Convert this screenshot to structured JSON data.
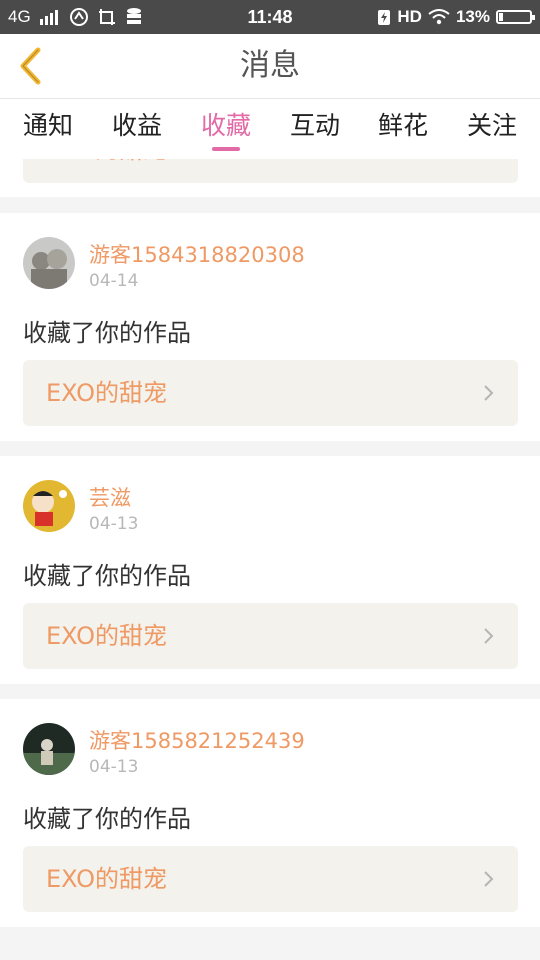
{
  "status_bar": {
    "network": "4G",
    "time": "11:48",
    "hd": "HD",
    "battery_percent": "13%",
    "battery_level": 0.13
  },
  "header": {
    "title": "消息",
    "back_icon": "chevron-left-icon"
  },
  "tabs": [
    {
      "label": "通知",
      "active": false
    },
    {
      "label": "收益",
      "active": false
    },
    {
      "label": "收藏",
      "active": true
    },
    {
      "label": "互动",
      "active": false
    },
    {
      "label": "鲜花",
      "active": false
    },
    {
      "label": "关注",
      "active": false
    }
  ],
  "partial_item": {
    "work_title": "EXO的甜宠"
  },
  "items": [
    {
      "username": "游客1584318820308",
      "date": "04-14",
      "action": "收藏了你的作品",
      "work_title": "EXO的甜宠"
    },
    {
      "username": "芸滋",
      "date": "04-13",
      "action": "收藏了你的作品",
      "work_title": "EXO的甜宠"
    },
    {
      "username": "游客1585821252439",
      "date": "04-13",
      "action": "收藏了你的作品",
      "work_title": "EXO的甜宠"
    }
  ],
  "colors": {
    "accent_pink": "#e26aa6",
    "username_orange": "#ef9964",
    "back_yellow": "#f2b632",
    "status_bar_bg": "#4a4a4a"
  }
}
